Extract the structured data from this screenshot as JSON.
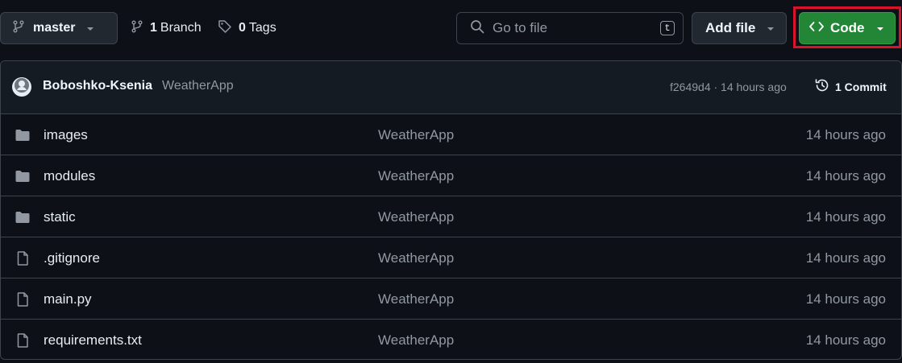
{
  "toolbar": {
    "branch_name": "master",
    "branches_count": "1",
    "branches_label": "Branch",
    "tags_count": "0",
    "tags_label": "Tags",
    "search_placeholder": "Go to file",
    "search_shortcut": "t",
    "add_file_label": "Add file",
    "code_label": "Code",
    "code_color": "#238636",
    "highlight_color": "#d7142a"
  },
  "commit": {
    "author": "Boboshko-Ksenia",
    "message": "WeatherApp",
    "hash_time": "f2649d4 · 14 hours ago",
    "commit_count": "1 Commit"
  },
  "files": [
    {
      "type": "folder",
      "name": "images",
      "message": "WeatherApp",
      "time": "14 hours ago"
    },
    {
      "type": "folder",
      "name": "modules",
      "message": "WeatherApp",
      "time": "14 hours ago"
    },
    {
      "type": "folder",
      "name": "static",
      "message": "WeatherApp",
      "time": "14 hours ago"
    },
    {
      "type": "file",
      "name": ".gitignore",
      "message": "WeatherApp",
      "time": "14 hours ago"
    },
    {
      "type": "file",
      "name": "main.py",
      "message": "WeatherApp",
      "time": "14 hours ago"
    },
    {
      "type": "file",
      "name": "requirements.txt",
      "message": "WeatherApp",
      "time": "14 hours ago"
    }
  ]
}
